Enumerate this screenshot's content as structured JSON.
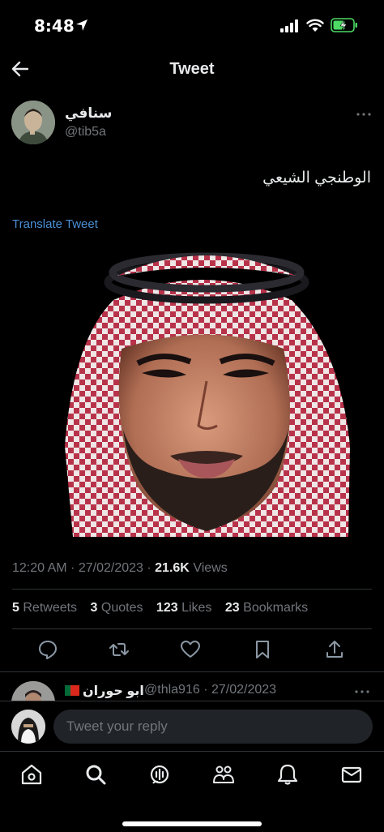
{
  "status_bar": {
    "time": "8:48"
  },
  "nav": {
    "title": "Tweet"
  },
  "author": {
    "name": "سنافي",
    "handle": "@tib5a"
  },
  "tweet": {
    "text": "الوطنجي الشيعي",
    "translate_label": "Translate Tweet",
    "time": "12:20 AM",
    "date": "27/02/2023",
    "views_count": "21.6K",
    "views_label": "Views"
  },
  "stats": {
    "retweets": {
      "count": "5",
      "label": "Retweets"
    },
    "quotes": {
      "count": "3",
      "label": "Quotes"
    },
    "likes": {
      "count": "123",
      "label": "Likes"
    },
    "bookmarks": {
      "count": "23",
      "label": "Bookmarks"
    }
  },
  "reply_preview": {
    "name": "ابو حوران",
    "handle": "@thla916",
    "date": "27/02/2023"
  },
  "composer": {
    "placeholder": "Tweet your reply"
  },
  "colors": {
    "background": "#000000",
    "link": "#4a8fd6",
    "muted": "#71767b",
    "text": "#e7e9ea",
    "battery": "#4cd964"
  }
}
